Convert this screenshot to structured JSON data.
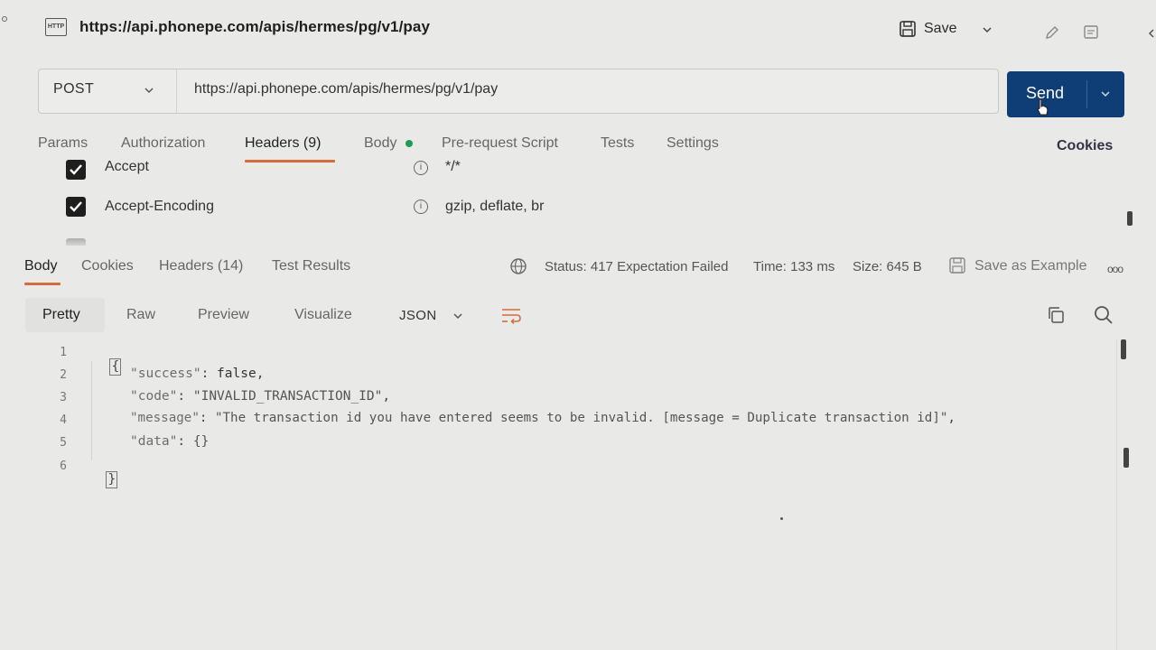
{
  "titlebar": {
    "icon": "http-icon",
    "icon_text": "HTTP",
    "url": "https://api.phonepe.com/apis/hermes/pg/v1/pay",
    "save_label": "Save"
  },
  "request": {
    "method": "POST",
    "url": "https://api.phonepe.com/apis/hermes/pg/v1/pay",
    "send_label": "Send",
    "send_color": "#0f3d75"
  },
  "request_tabs": [
    {
      "label": "Params"
    },
    {
      "label": "Authorization"
    },
    {
      "label": "Headers (9)",
      "active": true
    },
    {
      "label": "Body"
    },
    {
      "label": "Pre-request Script"
    },
    {
      "label": "Tests"
    },
    {
      "label": "Settings"
    }
  ],
  "cookies_label": "Cookies",
  "headers": [
    {
      "key": "Accept",
      "value": "*/*",
      "checked": true
    },
    {
      "key": "Accept-Encoding",
      "value": "gzip, deflate, br",
      "checked": true
    }
  ],
  "response_tabs": [
    {
      "label": "Body",
      "active": true
    },
    {
      "label": "Cookies"
    },
    {
      "label": "Headers (14)"
    },
    {
      "label": "Test Results"
    }
  ],
  "response_meta": {
    "status_label": "Status:",
    "status_value": "417 Expectation Failed",
    "time_label": "Time:",
    "time_value": "133 ms",
    "size_label": "Size:",
    "size_value": "645 B",
    "save_example_label": "Save as Example",
    "more": "ooo"
  },
  "format_tabs": [
    {
      "label": "Pretty",
      "active": true
    },
    {
      "label": "Raw"
    },
    {
      "label": "Preview"
    },
    {
      "label": "Visualize"
    }
  ],
  "format_select": "JSON",
  "code": {
    "line_numbers": [
      "1",
      "2",
      "3",
      "4",
      "5",
      "6"
    ],
    "open_brace": "{",
    "close_brace": "}",
    "l2_key": "\"success\"",
    "l2_sep": ": ",
    "l2_val": "false",
    "l2_end": ",",
    "l3_key": "\"code\"",
    "l3_sep": ": ",
    "l3_val": "\"INVALID_TRANSACTION_ID\"",
    "l3_end": ",",
    "l4_key": "\"message\"",
    "l4_sep": ": ",
    "l4_val": "\"The transaction id you have entered seems to be invalid. [message = Duplicate transaction id]\"",
    "l4_end": ",",
    "l5_key": "\"data\"",
    "l5_sep": ": ",
    "l5_val": "{}"
  },
  "colors": {
    "accent_underline": "#d76a3a",
    "body_dot": "#1d9a58"
  }
}
